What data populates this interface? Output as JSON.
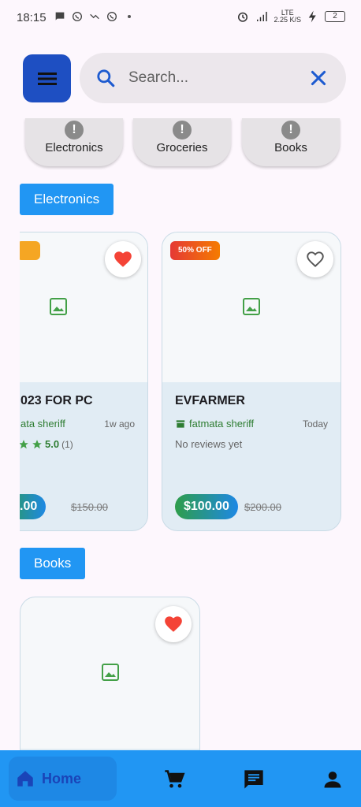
{
  "status_bar": {
    "time": "18:15",
    "network_top": "LTE",
    "network_bottom": "2.25 K/S",
    "battery": "2"
  },
  "search": {
    "placeholder": "Search..."
  },
  "categories": [
    {
      "label": "Electronics"
    },
    {
      "label": "Groceries"
    },
    {
      "label": "Books"
    }
  ],
  "sections": {
    "electronics": {
      "heading": "Electronics",
      "products": [
        {
          "title": "023 FOR PC",
          "seller": "ata sheriff",
          "time_ago": "1w ago",
          "rating": "5.0",
          "review_count": "(1)",
          "price": ".00",
          "old_price": "$150.00",
          "favorited": true
        },
        {
          "badge": "50% OFF",
          "title": "EVFARMER",
          "seller": "fatmata sheriff",
          "time_ago": "Today",
          "no_reviews": "No reviews yet",
          "price": "$100.00",
          "old_price": "$200.00",
          "favorited": false
        }
      ]
    },
    "books": {
      "heading": "Books",
      "products": [
        {
          "favorited": true
        }
      ]
    }
  },
  "bottom_nav": {
    "home_label": "Home",
    "icons": [
      "home-icon",
      "cart-icon",
      "chat-icon",
      "person-icon"
    ]
  },
  "colors": {
    "accent": "#2196f3",
    "menu_button": "#1e4fc2",
    "heart": "#f44336",
    "seller_green": "#2e7d32",
    "badge_red": "#e53935"
  }
}
